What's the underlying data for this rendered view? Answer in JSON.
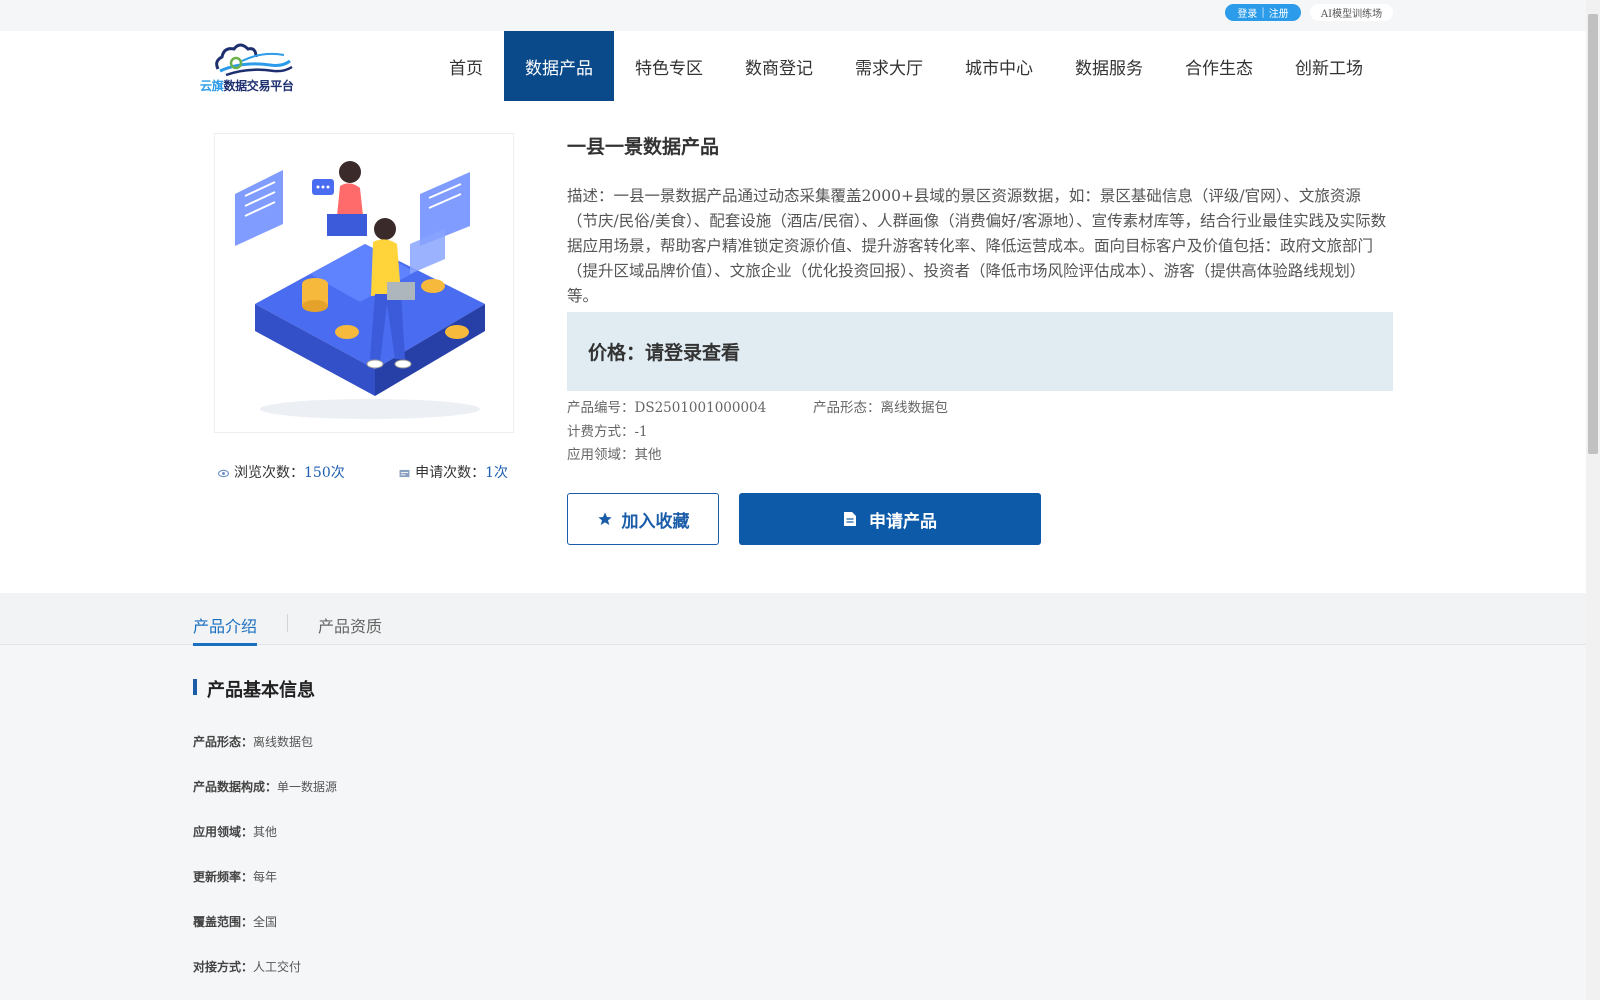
{
  "topbar": {
    "login": "登录",
    "separator": "|",
    "register": "注册",
    "ai_training": "AI模型训练场"
  },
  "logo": {
    "brand": "云旗",
    "name": "数据交易平台",
    "colors": {
      "primary": "#1d2f6f",
      "accent": "#2b9bea"
    }
  },
  "nav": {
    "items": [
      {
        "label": "首页"
      },
      {
        "label": "数据产品",
        "active": true
      },
      {
        "label": "特色专区"
      },
      {
        "label": "数商登记"
      },
      {
        "label": "需求大厅"
      },
      {
        "label": "城市中心"
      },
      {
        "label": "数据服务"
      },
      {
        "label": "合作生态"
      },
      {
        "label": "创新工场"
      }
    ],
    "active_color": "#0a4a8a"
  },
  "product": {
    "title": "一县一景数据产品",
    "description": "描述：一县一景数据产品通过动态采集覆盖2000+县域的景区资源数据，如：景区基础信息（评级/官网）、文旅资源（节庆/民俗/美食）、配套设施（酒店/民宿）、人群画像（消费偏好/客源地）、宣传素材库等，结合行业最佳实践及实际数据应用场景，帮助客户精准锁定资源价值、提升游客转化率、降低运营成本。面向目标客户及价值包括：政府文旅部门（提升区域品牌价值）、文旅企业（优化投资回报）、投资者（降低市场风险评估成本）、游客（提供高体验路线规划）等。",
    "price_label": "价格：请登录查看",
    "meta": {
      "code_label": "产品编号：",
      "code": "DS2501001000004",
      "form_label": "产品形态：",
      "form": "离线数据包",
      "billing_label": "计费方式：",
      "billing": "-1",
      "domain_label": "应用领域：",
      "domain": "其他"
    },
    "stats": {
      "views_label": "浏览次数：",
      "views": "150次",
      "applies_label": "申请次数：",
      "applies": "1次"
    },
    "buttons": {
      "favorite": "加入收藏",
      "apply": "申请产品"
    },
    "icons": {
      "views": "eye-icon",
      "applies": "card-icon",
      "favorite": "star-icon",
      "apply": "document-icon"
    }
  },
  "tabs": [
    {
      "label": "产品介绍",
      "active": true
    },
    {
      "label": "产品资质"
    }
  ],
  "basic_info": {
    "title": "产品基本信息",
    "rows": [
      {
        "key": "产品形态：",
        "value": "离线数据包"
      },
      {
        "key": "产品数据构成：",
        "value": "单一数据源"
      },
      {
        "key": "应用领域：",
        "value": "其他"
      },
      {
        "key": "更新频率：",
        "value": "每年"
      },
      {
        "key": "覆盖范围：",
        "value": "全国"
      },
      {
        "key": "对接方式：",
        "value": "人工交付"
      }
    ]
  }
}
